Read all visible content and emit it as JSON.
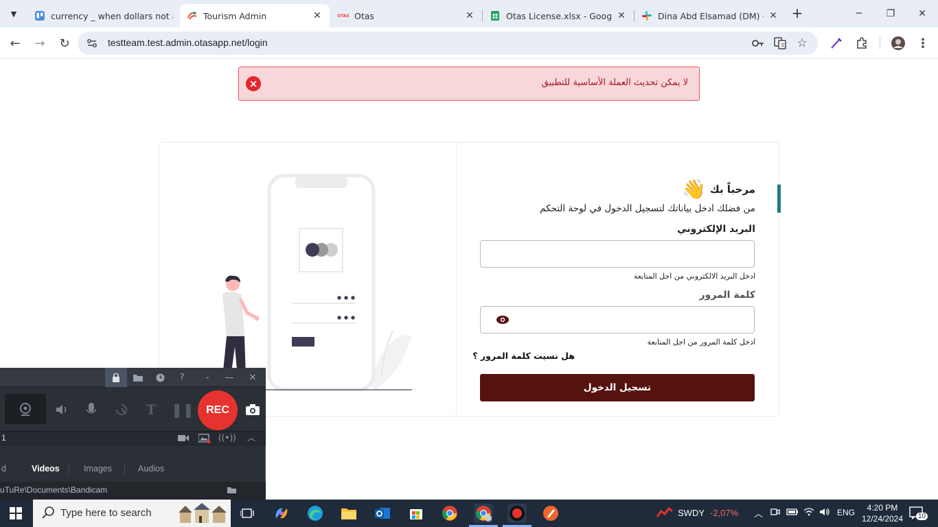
{
  "browser": {
    "tabs": [
      {
        "title": "currency _ when dollars not a",
        "active": false
      },
      {
        "title": "Tourism Admin",
        "active": true
      },
      {
        "title": "Otas",
        "active": false
      },
      {
        "title": "Otas License.xlsx - Google Sh",
        "active": false
      },
      {
        "title": "Dina Abd Elsamad (DM) - Sc",
        "active": false
      }
    ],
    "url": "testteam.test.admin.otasapp.net/login",
    "otas_logo_text": "OTAS"
  },
  "alert": {
    "message": "لا يمكن تحديث العملة الأساسية للتطبيق",
    "icon": "close-circle-icon",
    "color": "#e4262f"
  },
  "login": {
    "welcome": "مرحباً بك",
    "wave_emoji": "👋",
    "subtitle": "من فضلك ادخل بياناتك لتسجيل الدخول في لوحة التحكم",
    "email_label": "البريد الإلكتروني",
    "email_value": "",
    "email_hint": "ادخل البريد الالكتروني من اجل المتابعة",
    "password_label": "كلمة المرور",
    "password_value": "",
    "password_hint": "ادخل كلمة المرور من اجل المتابعة",
    "forgot": "هل نسيت كلمة المرور ؟",
    "submit": "تسجيل الدخول",
    "button_color": "#55130f",
    "accent_color": "#1e7c7c"
  },
  "bandicam": {
    "rec_label": "REC",
    "counter": "1",
    "tabs": [
      "d",
      "Videos",
      "Images",
      "Audios"
    ],
    "active_tab": "Videos",
    "path": "uTuRe\\Documents\\Bandicam"
  },
  "taskbar": {
    "search_placeholder": "Type here to search",
    "weather_ticker": "SWDY",
    "weather_change": "-2,07%",
    "language": "ENG",
    "time": "4:20 PM",
    "date": "12/24/2024",
    "notifications": "10"
  }
}
